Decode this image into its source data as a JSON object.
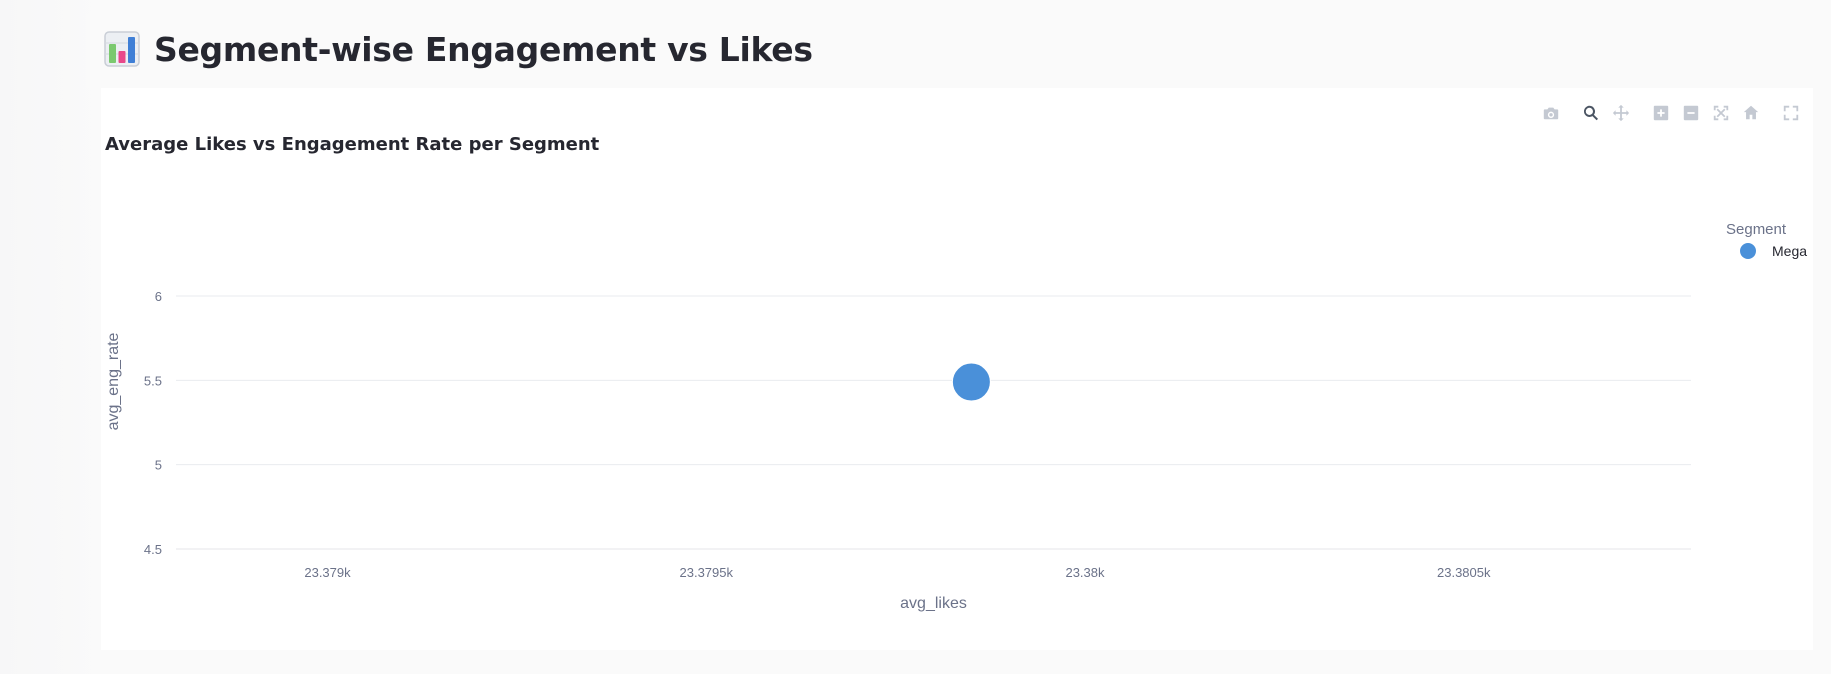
{
  "page": {
    "title": "Segment-wise Engagement vs Likes",
    "title_icon": "bar-chart-icon"
  },
  "modebar": [
    {
      "name": "download-plot-png-button",
      "icon": "camera-icon",
      "label": "Download plot as a png",
      "active": false
    },
    {
      "name": "zoom-button",
      "icon": "zoom-magnifier-icon",
      "label": "Zoom",
      "active": true
    },
    {
      "name": "pan-button",
      "icon": "pan-arrows-icon",
      "label": "Pan",
      "active": false
    },
    {
      "name": "zoom-in-button",
      "icon": "zoom-in-icon",
      "label": "Zoom in",
      "active": false
    },
    {
      "name": "zoom-out-button",
      "icon": "zoom-out-icon",
      "label": "Zoom out",
      "active": false
    },
    {
      "name": "autoscale-button",
      "icon": "autoscale-icon",
      "label": "Autoscale",
      "active": false
    },
    {
      "name": "reset-axes-button",
      "icon": "home-icon",
      "label": "Reset axes",
      "active": false
    },
    {
      "name": "fullscreen-button",
      "icon": "fullscreen-icon",
      "label": "View fullscreen",
      "active": false
    }
  ],
  "chart_data": {
    "type": "scatter",
    "title": "Average Likes vs Engagement Rate per Segment",
    "xlabel": "avg_likes",
    "ylabel": "avg_eng_rate",
    "xlim": [
      23378.8,
      23380.8
    ],
    "ylim": [
      4.5,
      6.1
    ],
    "x_ticks": [
      23379,
      23379.5,
      23380,
      23380.5
    ],
    "x_tick_labels": [
      "23.379k",
      "23.3795k",
      "23.38k",
      "23.3805k"
    ],
    "y_ticks": [
      4.5,
      5,
      5.5,
      6
    ],
    "y_tick_labels": [
      "4.5",
      "5",
      "5.5",
      "6"
    ],
    "grid": true,
    "legend": {
      "title": "Segment",
      "placement": "top-right"
    },
    "series": [
      {
        "name": "Mega",
        "color": "#4a90d9",
        "points": [
          {
            "x": 23379.85,
            "y": 5.49
          }
        ]
      }
    ]
  }
}
